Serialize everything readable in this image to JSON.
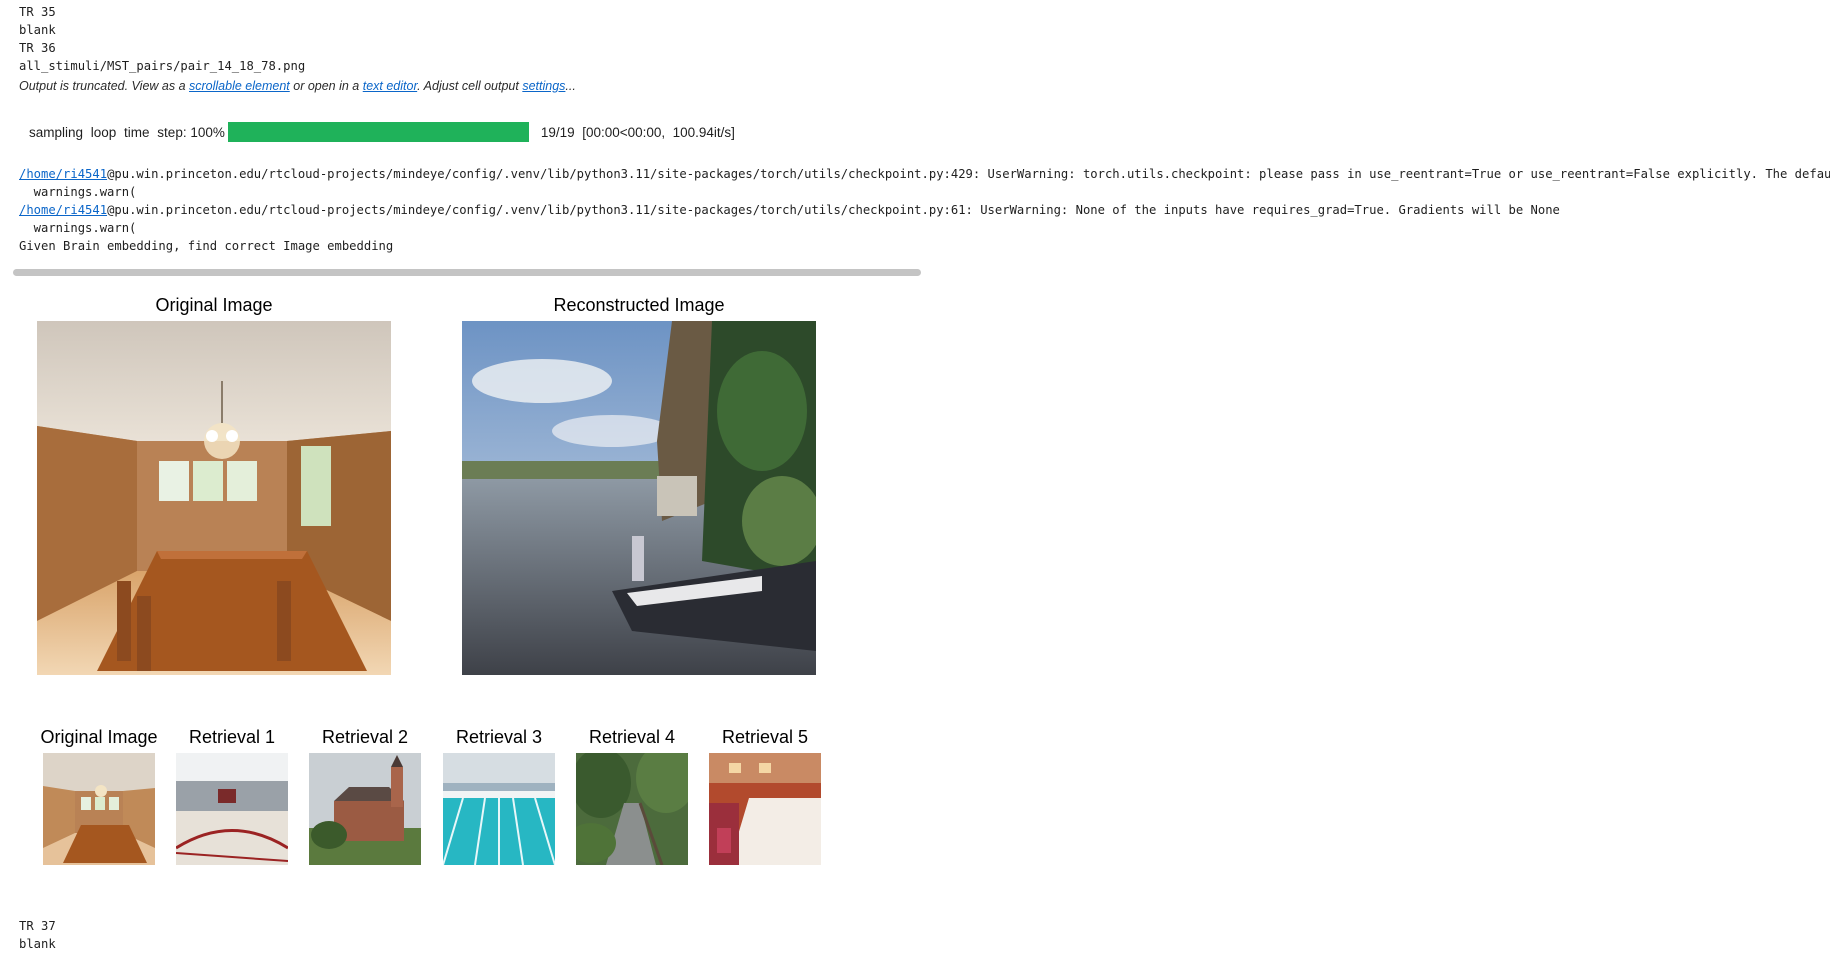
{
  "output_lines": {
    "tr35": "TR 35",
    "blank1": "blank",
    "tr36": "TR 36",
    "file": "all_stimuli/MST_pairs/pair_14_18_78.png",
    "tr37": "TR 37",
    "blank2": "blank"
  },
  "truncation": {
    "prefix": "Output is truncated. View as a ",
    "scrollable_link": "scrollable element",
    "middle": " or open in a ",
    "editor_link": "text editor",
    "middle2": ". Adjust cell output ",
    "settings_link": "settings",
    "suffix": "..."
  },
  "progress": {
    "label": "sampling loop time step:",
    "percent": "100%",
    "fraction": 1.0,
    "counter": "19/19",
    "stats": "[00:00<00:00,  100.94it/s]",
    "color": "#1fb25a"
  },
  "warnings": {
    "path_link_1": "/home/ri4541",
    "rest_1": "@pu.win.princeton.edu/rtcloud-projects/mindeye/config/.venv/lib/python3.11/site-packages/torch/utils/checkpoint.py:429: UserWarning: torch.utils.checkpoint: please pass in use_reentrant=True or use_reentrant=False explicitly. The default",
    "warn_call_1": "  warnings.warn(",
    "path_link_2": "/home/ri4541",
    "rest_2": "@pu.win.princeton.edu/rtcloud-projects/mindeye/config/.venv/lib/python3.11/site-packages/torch/utils/checkpoint.py:61: UserWarning: None of the inputs have requires_grad=True. Gradients will be None",
    "warn_call_2": "  warnings.warn(",
    "given": "Given Brain embedding, find correct Image embedding"
  },
  "figure1": {
    "original_title": "Original Image",
    "reconstructed_title": "Reconstructed Image"
  },
  "figure2": {
    "titles": [
      "Original Image",
      "Retrieval 1",
      "Retrieval 2",
      "Retrieval 3",
      "Retrieval 4",
      "Retrieval 5"
    ]
  }
}
